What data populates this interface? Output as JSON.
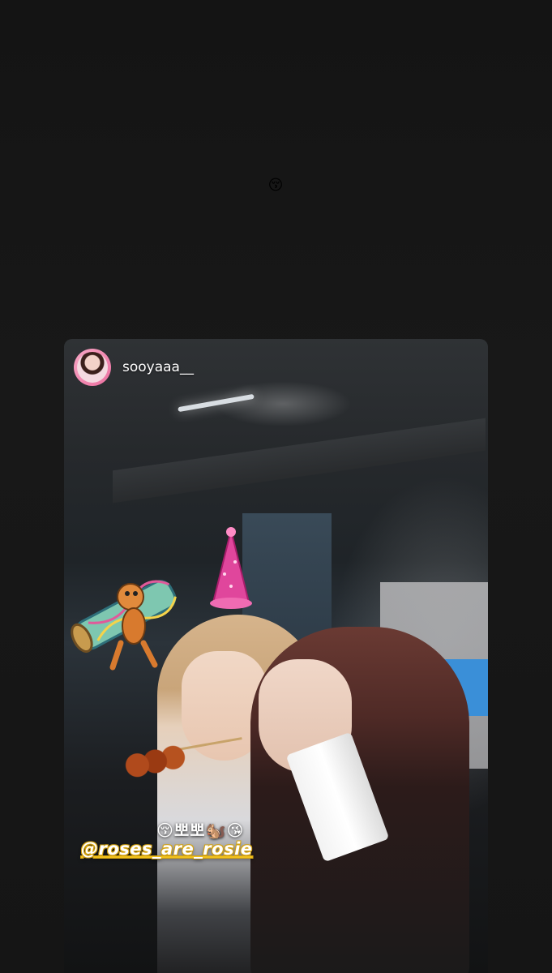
{
  "story": {
    "top_emoji": "😚"
  },
  "shared_post": {
    "username": "sooyaaa__",
    "caption": "😚뽀뽀🐿️😘",
    "mention": "@roses_are_rosie"
  },
  "icons": {
    "avatar": "profile-avatar",
    "sticker_chipmunk": "chipmunk-sticker",
    "sticker_hat": "party-hat-sticker"
  },
  "colors": {
    "background": "#141414",
    "mention_outline": "#d4a312",
    "avatar_ring": "#ec6fa0"
  }
}
